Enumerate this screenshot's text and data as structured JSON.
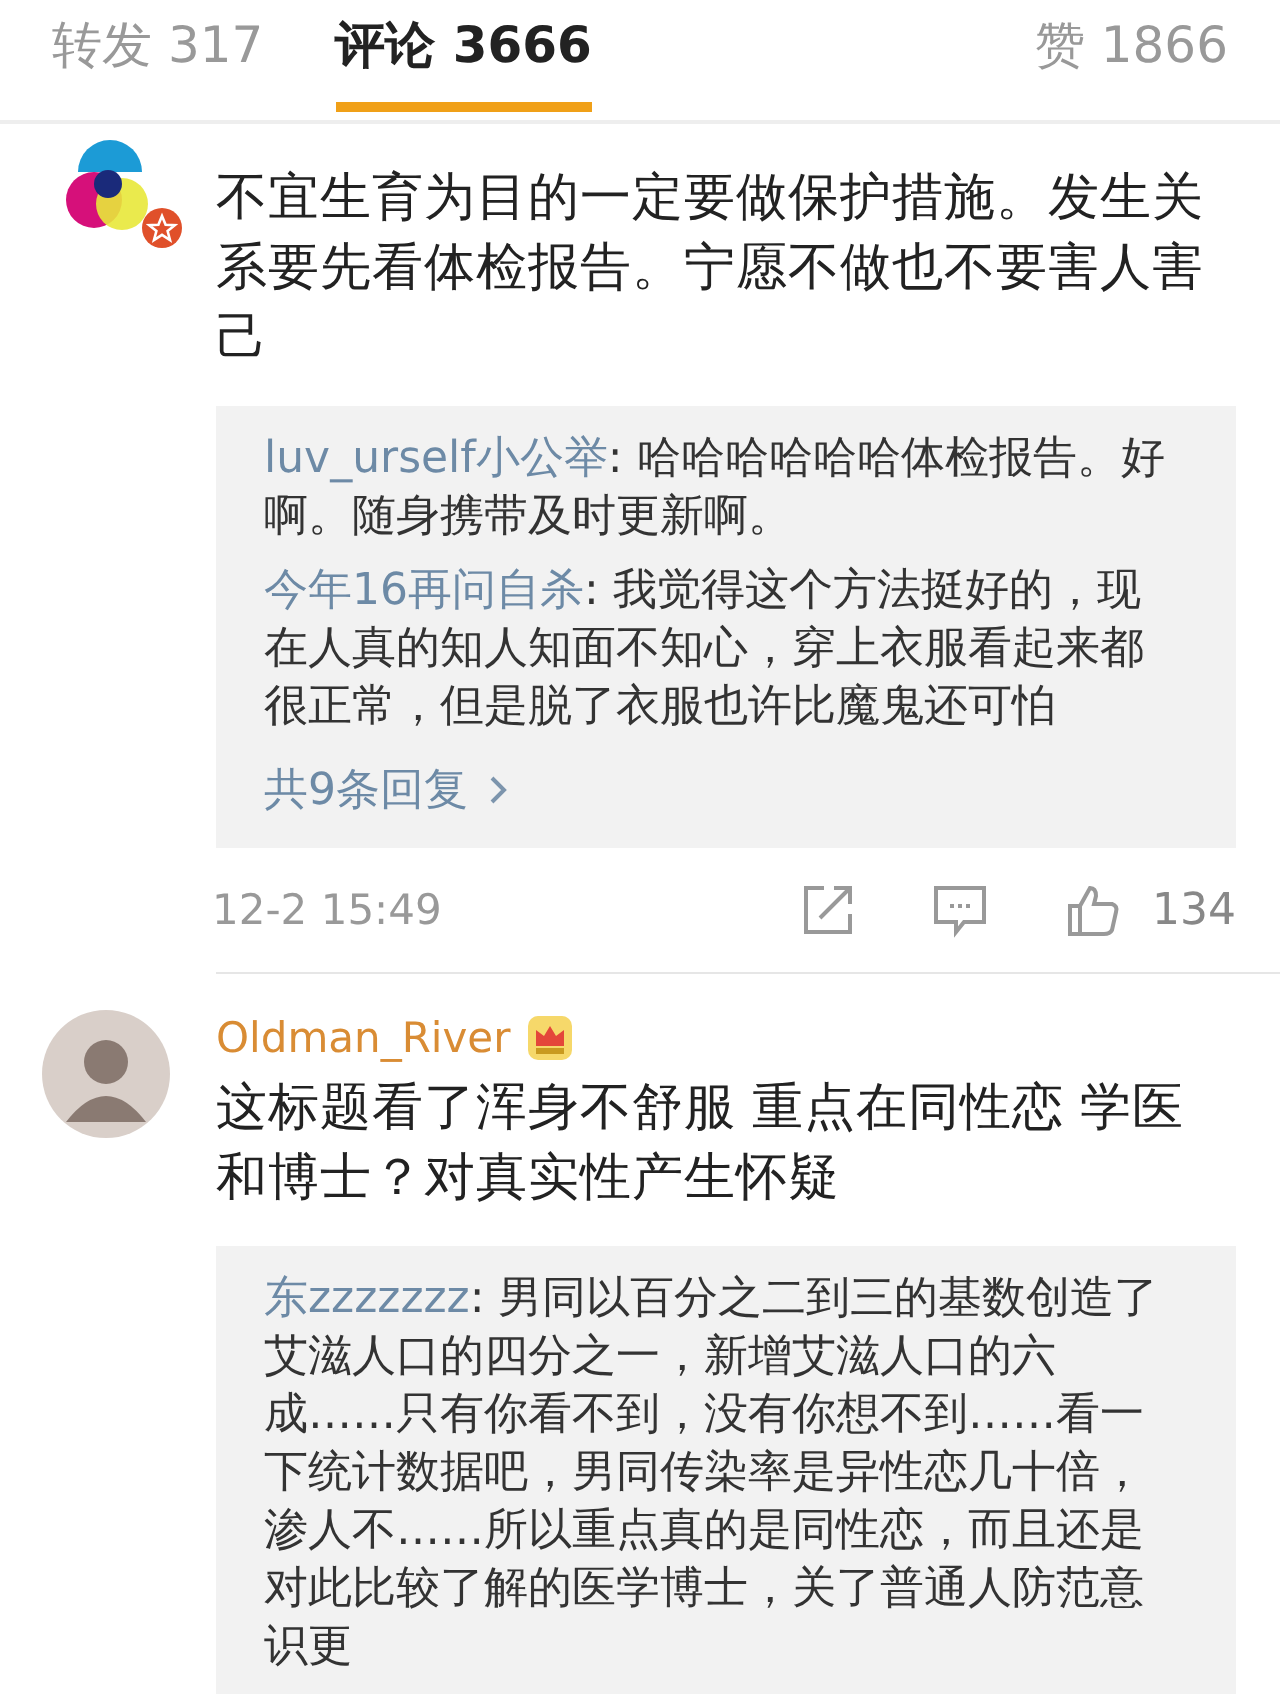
{
  "tabs": [
    {
      "label": "转发 317",
      "selected": false
    },
    {
      "label": "评论 3666",
      "selected": true
    },
    {
      "label": "赞 1866",
      "selected": false
    }
  ],
  "comments": [
    {
      "verified": true,
      "photo": false,
      "text": "不宜生育为目的一定要做保护措施。发生关系要先看体检报告。宁愿不做也不要害人害己",
      "replies": [
        {
          "author": "luv_urself小公举",
          "text": ": 哈哈哈哈哈哈体检报告。好啊。随身携带及时更新啊。"
        },
        {
          "author": "今年16再问自杀",
          "text": ": 我觉得这个方法挺好的，现在人真的知人知面不知心，穿上衣服看起来都很正常，但是脱了衣服也许比魔鬼还可怕"
        }
      ],
      "more_replies": "共9条回复",
      "time": "12-2 15:49",
      "likes": "134"
    },
    {
      "username": "Oldman_River",
      "vip": true,
      "photo": true,
      "text": "这标题看了浑身不舒服 重点在同性恋 学医和博士？对真实性产生怀疑",
      "replies": [
        {
          "author": "东zzzzzzz",
          "text": ": 男同以百分之二到三的基数创造了艾滋人口的四分之一，新增艾滋人口的六成……只有你看不到，没有你想不到……看一下统计数据吧，男同传染率是异性恋几十倍，渗人不……所以重点真的是同性恋，而且还是对此比较了解的医学博士，关了普通人防范意识更"
        }
      ]
    }
  ]
}
